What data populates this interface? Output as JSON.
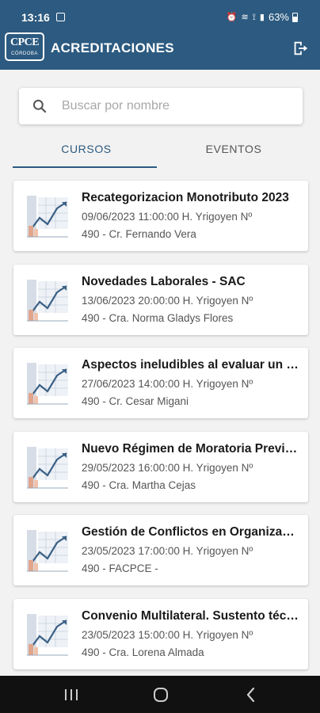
{
  "status_bar": {
    "time": "13:16",
    "icons": "⏰ ≋ ⟟ ▮",
    "battery": "63%"
  },
  "app_bar": {
    "logo_text": "CPCE",
    "logo_subtext": "CÓRDOBA",
    "title": "ACREDITACIONES"
  },
  "search": {
    "placeholder": "Buscar por nombre"
  },
  "tabs": [
    {
      "label": "CURSOS",
      "active": true
    },
    {
      "label": "EVENTOS",
      "active": false
    }
  ],
  "cards": [
    {
      "title": "Recategorizacion Monotributo 2023",
      "line1": "09/06/2023 11:00:00 H. Yrigoyen Nº",
      "line2": "490 - Cr. Fernando Vera"
    },
    {
      "title": "Novedades Laborales - SAC",
      "line1": "13/06/2023 20:00:00 H. Yrigoyen Nº",
      "line2": "490 - Cra. Norma Gladys Flores"
    },
    {
      "title": "Aspectos ineludibles al evaluar un balance",
      "line1": "27/06/2023 14:00:00 H. Yrigoyen Nº",
      "line2": "490 - Cr. Cesar Migani"
    },
    {
      "title": "Nuevo Régimen de Moratoria Previsional",
      "line1": "29/05/2023 16:00:00 H. Yrigoyen Nº",
      "line2": "490 - Cra. Martha Cejas"
    },
    {
      "title": "Gestión de Conflictos en Organizaciones",
      "line1": "23/05/2023 17:00:00 H. Yrigoyen Nº",
      "line2": "490 - FACPCE -"
    },
    {
      "title": "Convenio Multilateral. Sustento técnico",
      "line1": "23/05/2023 15:00:00 H. Yrigoyen Nº",
      "line2": "490 - Cra. Lorena Almada"
    }
  ],
  "colors": {
    "primary": "#2c5a80",
    "background": "#f2f2f2",
    "nav_bar": "#111111"
  },
  "icons": {
    "logout": "logout-icon",
    "search": "search-icon",
    "thumbnail": "finance-chart-thumbnail",
    "nav": [
      "recent-apps-icon",
      "home-icon",
      "back-icon"
    ]
  }
}
